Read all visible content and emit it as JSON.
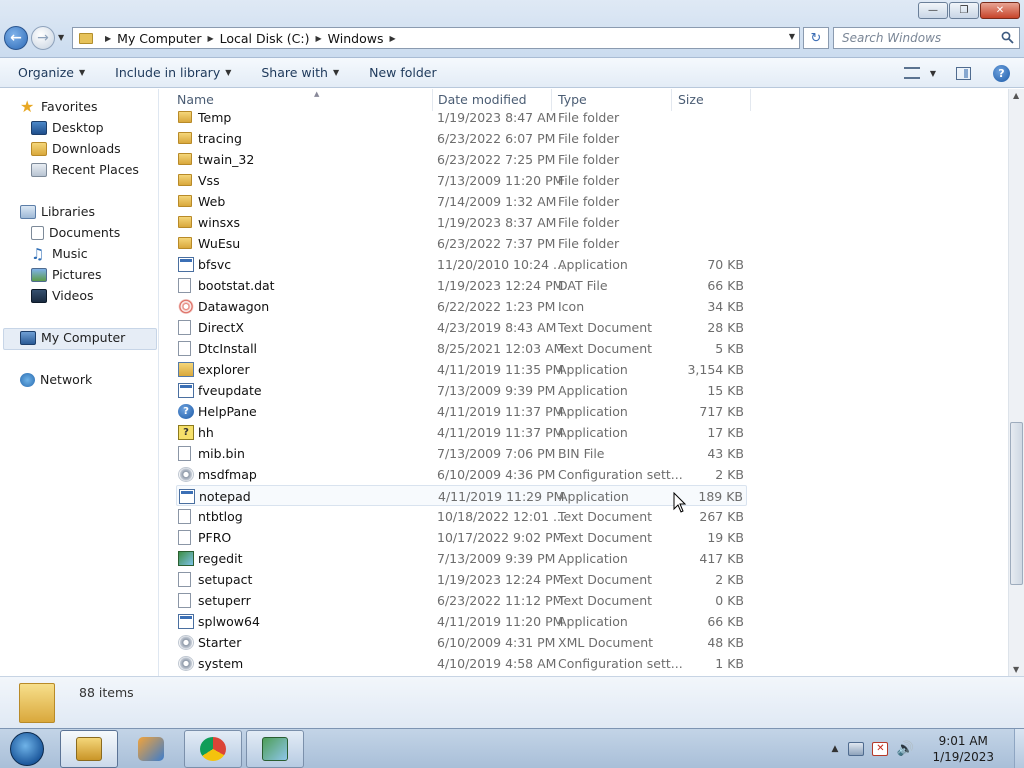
{
  "window": {
    "address": {
      "crumbs": [
        "My Computer",
        "Local Disk (C:)",
        "Windows"
      ]
    },
    "search_placeholder": "Search Windows",
    "controls": [
      "minimize",
      "maximize",
      "close"
    ]
  },
  "toolbar": {
    "organize": "Organize",
    "include_in_library": "Include in library",
    "share_with": "Share with",
    "new_folder": "New folder"
  },
  "navpane": {
    "favorites": "Favorites",
    "favorites_items": [
      "Desktop",
      "Downloads",
      "Recent Places"
    ],
    "libraries": "Libraries",
    "libraries_items": [
      "Documents",
      "Music",
      "Pictures",
      "Videos"
    ],
    "my_computer": "My Computer",
    "network": "Network"
  },
  "columns": {
    "name": "Name",
    "date": "Date modified",
    "type": "Type",
    "size": "Size"
  },
  "files": [
    {
      "name": "Temp",
      "date": "1/19/2023 8:47 AM",
      "type": "File folder",
      "size": "",
      "icon": "folder-icon"
    },
    {
      "name": "tracing",
      "date": "6/23/2022 6:07 PM",
      "type": "File folder",
      "size": "",
      "icon": "folder-icon"
    },
    {
      "name": "twain_32",
      "date": "6/23/2022 7:25 PM",
      "type": "File folder",
      "size": "",
      "icon": "folder-icon"
    },
    {
      "name": "Vss",
      "date": "7/13/2009 11:20 PM",
      "type": "File folder",
      "size": "",
      "icon": "folder-icon"
    },
    {
      "name": "Web",
      "date": "7/14/2009 1:32 AM",
      "type": "File folder",
      "size": "",
      "icon": "folder-icon"
    },
    {
      "name": "winsxs",
      "date": "1/19/2023 8:37 AM",
      "type": "File folder",
      "size": "",
      "icon": "folder-icon"
    },
    {
      "name": "WuEsu",
      "date": "6/23/2022 7:37 PM",
      "type": "File folder",
      "size": "",
      "icon": "folder-icon"
    },
    {
      "name": "bfsvc",
      "date": "11/20/2010 10:24 ...",
      "type": "Application",
      "size": "70 KB",
      "icon": "application-icon"
    },
    {
      "name": "bootstat.dat",
      "date": "1/19/2023 12:24 PM",
      "type": "DAT File",
      "size": "66 KB",
      "icon": "document-icon"
    },
    {
      "name": "Datawagon",
      "date": "6/22/2022 1:23 PM",
      "type": "Icon",
      "size": "34 KB",
      "icon": "icon-file-icon"
    },
    {
      "name": "DirectX",
      "date": "4/23/2019 8:43 AM",
      "type": "Text Document",
      "size": "28 KB",
      "icon": "document-icon"
    },
    {
      "name": "DtcInstall",
      "date": "8/25/2021 12:03 AM",
      "type": "Text Document",
      "size": "5 KB",
      "icon": "document-icon"
    },
    {
      "name": "explorer",
      "date": "4/11/2019 11:35 PM",
      "type": "Application",
      "size": "3,154 KB",
      "icon": "explorer-icon"
    },
    {
      "name": "fveupdate",
      "date": "7/13/2009 9:39 PM",
      "type": "Application",
      "size": "15 KB",
      "icon": "application-icon"
    },
    {
      "name": "HelpPane",
      "date": "4/11/2019 11:37 PM",
      "type": "Application",
      "size": "717 KB",
      "icon": "help-icon"
    },
    {
      "name": "hh",
      "date": "4/11/2019 11:37 PM",
      "type": "Application",
      "size": "17 KB",
      "icon": "help-file-icon"
    },
    {
      "name": "mib.bin",
      "date": "7/13/2009 7:06 PM",
      "type": "BIN File",
      "size": "43 KB",
      "icon": "document-icon"
    },
    {
      "name": "msdfmap",
      "date": "6/10/2009 4:36 PM",
      "type": "Configuration sett...",
      "size": "2 KB",
      "icon": "config-icon"
    },
    {
      "name": "notepad",
      "date": "4/11/2019 11:29 PM",
      "type": "Application",
      "size": "189 KB",
      "icon": "notepad-icon"
    },
    {
      "name": "ntbtlog",
      "date": "10/18/2022 12:01 ...",
      "type": "Text Document",
      "size": "267 KB",
      "icon": "document-icon"
    },
    {
      "name": "PFRO",
      "date": "10/17/2022 9:02 PM",
      "type": "Text Document",
      "size": "19 KB",
      "icon": "document-icon"
    },
    {
      "name": "regedit",
      "date": "7/13/2009 9:39 PM",
      "type": "Application",
      "size": "417 KB",
      "icon": "regedit-icon"
    },
    {
      "name": "setupact",
      "date": "1/19/2023 12:24 PM",
      "type": "Text Document",
      "size": "2 KB",
      "icon": "document-icon"
    },
    {
      "name": "setuperr",
      "date": "6/23/2022 11:12 PM",
      "type": "Text Document",
      "size": "0 KB",
      "icon": "document-icon"
    },
    {
      "name": "splwow64",
      "date": "4/11/2019 11:20 PM",
      "type": "Application",
      "size": "66 KB",
      "icon": "application-icon"
    },
    {
      "name": "Starter",
      "date": "6/10/2009 4:31 PM",
      "type": "XML Document",
      "size": "48 KB",
      "icon": "xml-icon"
    },
    {
      "name": "system",
      "date": "4/10/2019 4:58 AM",
      "type": "Configuration sett...",
      "size": "1 KB",
      "icon": "config-icon"
    }
  ],
  "hovered_file": "notepad",
  "details": {
    "item_count": "88 items"
  },
  "taskbar": {
    "apps": [
      "explorer-icon",
      "media-player-icon",
      "chrome-icon",
      "network-app-icon"
    ],
    "clock_time": "9:01 AM",
    "clock_date": "1/19/2023"
  }
}
